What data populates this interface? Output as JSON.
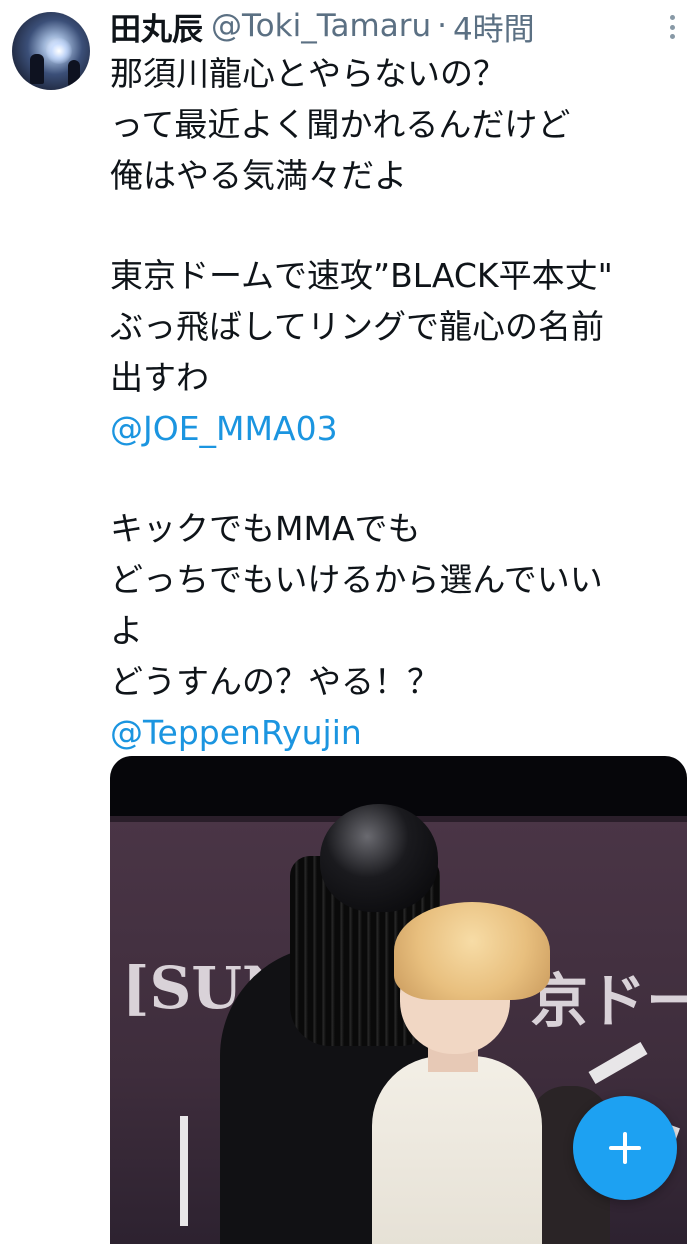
{
  "tweet": {
    "display_name": "田丸辰",
    "handle": "@Toki_Tamaru",
    "separator": "·",
    "time": "4時間",
    "more_icon": "more-vertical-icon",
    "lines": [
      "那須川龍心とやらないの？",
      "って最近よく聞かれるんだけど",
      "俺はやる気満々だよ",
      "",
      "東京ドームで速攻”BLACK平本丈\"",
      "ぶっ飛ばしてリングで龍心の名前",
      "出すわ",
      "@JOE_MMA03",
      "",
      "キックでもMMAでも",
      "どっちでもいけるから選んでいい",
      "よ",
      "どうすんの？やる！？",
      "@TeppenRyujin"
    ],
    "media": {
      "sign_left": "[SUN",
      "sign_right": "京ドー"
    }
  },
  "compose_button": {
    "icon": "plus-icon"
  },
  "colors": {
    "text": "#0f1419",
    "secondary": "#5b7083",
    "mention": "#1b95e0",
    "accent": "#1da1f2"
  }
}
